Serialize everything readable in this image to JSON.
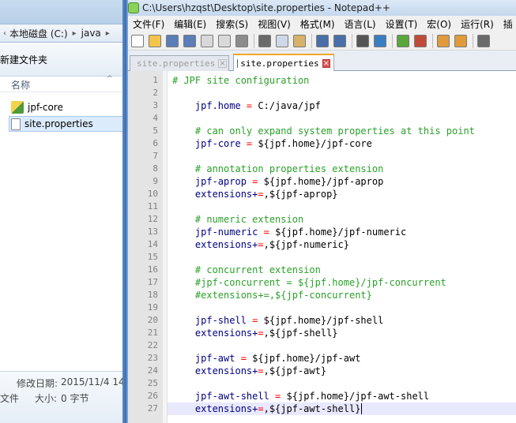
{
  "explorer": {
    "address": [
      "本地磁盘 (C:)",
      "java"
    ],
    "toolbar_label": "新建文件夹",
    "column_header": "名称",
    "files": [
      {
        "name": "jpf-core",
        "icon": "jar-file-icon"
      },
      {
        "name": "site.properties",
        "icon": "text-file-icon"
      }
    ],
    "details": {
      "modified_label": "修改日期:",
      "modified_value": "2015/11/4 14",
      "type_label": "文件",
      "size_label": "大小:",
      "size_value": "0 字节"
    }
  },
  "notepadpp": {
    "title": "C:\\Users\\hzqst\\Desktop\\site.properties - Notepad++",
    "menu": [
      "文件(F)",
      "编辑(E)",
      "搜索(S)",
      "视图(V)",
      "格式(M)",
      "语言(L)",
      "设置(T)",
      "宏(O)",
      "运行(R)",
      "插"
    ],
    "tabs": [
      {
        "label": "site.properties",
        "active": false
      },
      {
        "label": "site.properties",
        "active": true
      }
    ],
    "lines": [
      {
        "n": "1",
        "type": "comment",
        "text": "# JPF site configuration"
      },
      {
        "n": "2",
        "type": "blank"
      },
      {
        "n": "3",
        "type": "kv",
        "indent": "    ",
        "key": "jpf.home",
        "op": " = ",
        "val": "C:/java/jpf"
      },
      {
        "n": "4",
        "type": "blank"
      },
      {
        "n": "5",
        "type": "comment",
        "indent": "    ",
        "text": "# can only expand system properties at this point"
      },
      {
        "n": "6",
        "type": "kv",
        "indent": "    ",
        "key": "jpf-core",
        "op": " = ",
        "val": "${jpf.home}/jpf-core"
      },
      {
        "n": "7",
        "type": "blank"
      },
      {
        "n": "8",
        "type": "comment",
        "indent": "    ",
        "text": "# annotation properties extension"
      },
      {
        "n": "9",
        "type": "kv",
        "indent": "    ",
        "key": "jpf-aprop",
        "op": " = ",
        "val": "${jpf.home}/jpf-aprop"
      },
      {
        "n": "10",
        "type": "kv",
        "indent": "    ",
        "key": "extensions+",
        "op": "=",
        "val": ",${jpf-aprop}"
      },
      {
        "n": "11",
        "type": "blank"
      },
      {
        "n": "12",
        "type": "comment",
        "indent": "    ",
        "text": "# numeric extension"
      },
      {
        "n": "13",
        "type": "kv",
        "indent": "    ",
        "key": "jpf-numeric",
        "op": " = ",
        "val": "${jpf.home}/jpf-numeric"
      },
      {
        "n": "14",
        "type": "kv",
        "indent": "    ",
        "key": "extensions+",
        "op": "=",
        "val": ",${jpf-numeric}"
      },
      {
        "n": "15",
        "type": "blank"
      },
      {
        "n": "16",
        "type": "comment",
        "indent": "    ",
        "text": "# concurrent extension"
      },
      {
        "n": "17",
        "type": "comment",
        "indent": "    ",
        "text": "#jpf-concurrent = ${jpf.home}/jpf-concurrent"
      },
      {
        "n": "18",
        "type": "comment",
        "indent": "    ",
        "text": "#extensions+=,${jpf-concurrent}"
      },
      {
        "n": "19",
        "type": "blank"
      },
      {
        "n": "20",
        "type": "kv",
        "indent": "    ",
        "key": "jpf-shell",
        "op": " = ",
        "val": "${jpf.home}/jpf-shell"
      },
      {
        "n": "21",
        "type": "kv",
        "indent": "    ",
        "key": "extensions+",
        "op": "=",
        "val": ",${jpf-shell}"
      },
      {
        "n": "22",
        "type": "blank"
      },
      {
        "n": "23",
        "type": "kv",
        "indent": "    ",
        "key": "jpf-awt",
        "op": " = ",
        "val": "${jpf.home}/jpf-awt"
      },
      {
        "n": "24",
        "type": "kv",
        "indent": "    ",
        "key": "extensions+",
        "op": "=",
        "val": ",${jpf-awt}"
      },
      {
        "n": "25",
        "type": "blank"
      },
      {
        "n": "26",
        "type": "kv",
        "indent": "    ",
        "key": "jpf-awt-shell",
        "op": " = ",
        "val": "${jpf.home}/jpf-awt-shell"
      },
      {
        "n": "27",
        "type": "kv",
        "indent": "    ",
        "key": "extensions+",
        "op": "=",
        "val": ",${jpf-awt-shell}",
        "current": true
      }
    ],
    "toolbar_icons": [
      "new-file-icon",
      "open-file-icon",
      "save-icon",
      "save-all-icon",
      "close-icon",
      "close-all-icon",
      "print-icon",
      "sep",
      "cut-icon",
      "copy-icon",
      "paste-icon",
      "sep",
      "undo-icon",
      "redo-icon",
      "sep",
      "find-icon",
      "replace-icon",
      "sep",
      "zoom-in-icon",
      "zoom-out-icon",
      "sep",
      "sync-v-icon",
      "sync-h-icon",
      "sep",
      "wrap-icon"
    ]
  },
  "colors": {
    "comment": "#2aa12a",
    "key": "#000080",
    "operator": "#ff0000",
    "gutter": "#e4e4e4",
    "active_tab_accent": "#f5a623"
  }
}
